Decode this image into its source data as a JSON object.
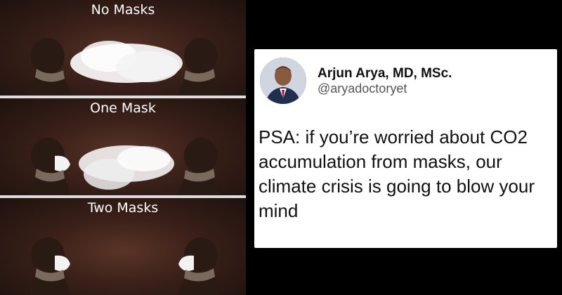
{
  "meme": {
    "panels": [
      {
        "label": "No Masks"
      },
      {
        "label": "One Mask"
      },
      {
        "label": "Two Masks"
      }
    ]
  },
  "tweet": {
    "name": "Arjun Arya, MD, MSc.",
    "handle": "@aryadoctoryet",
    "text": "PSA: if you’re worried about CO2 accumulation from masks, our climate crisis is going to blow your mind"
  }
}
